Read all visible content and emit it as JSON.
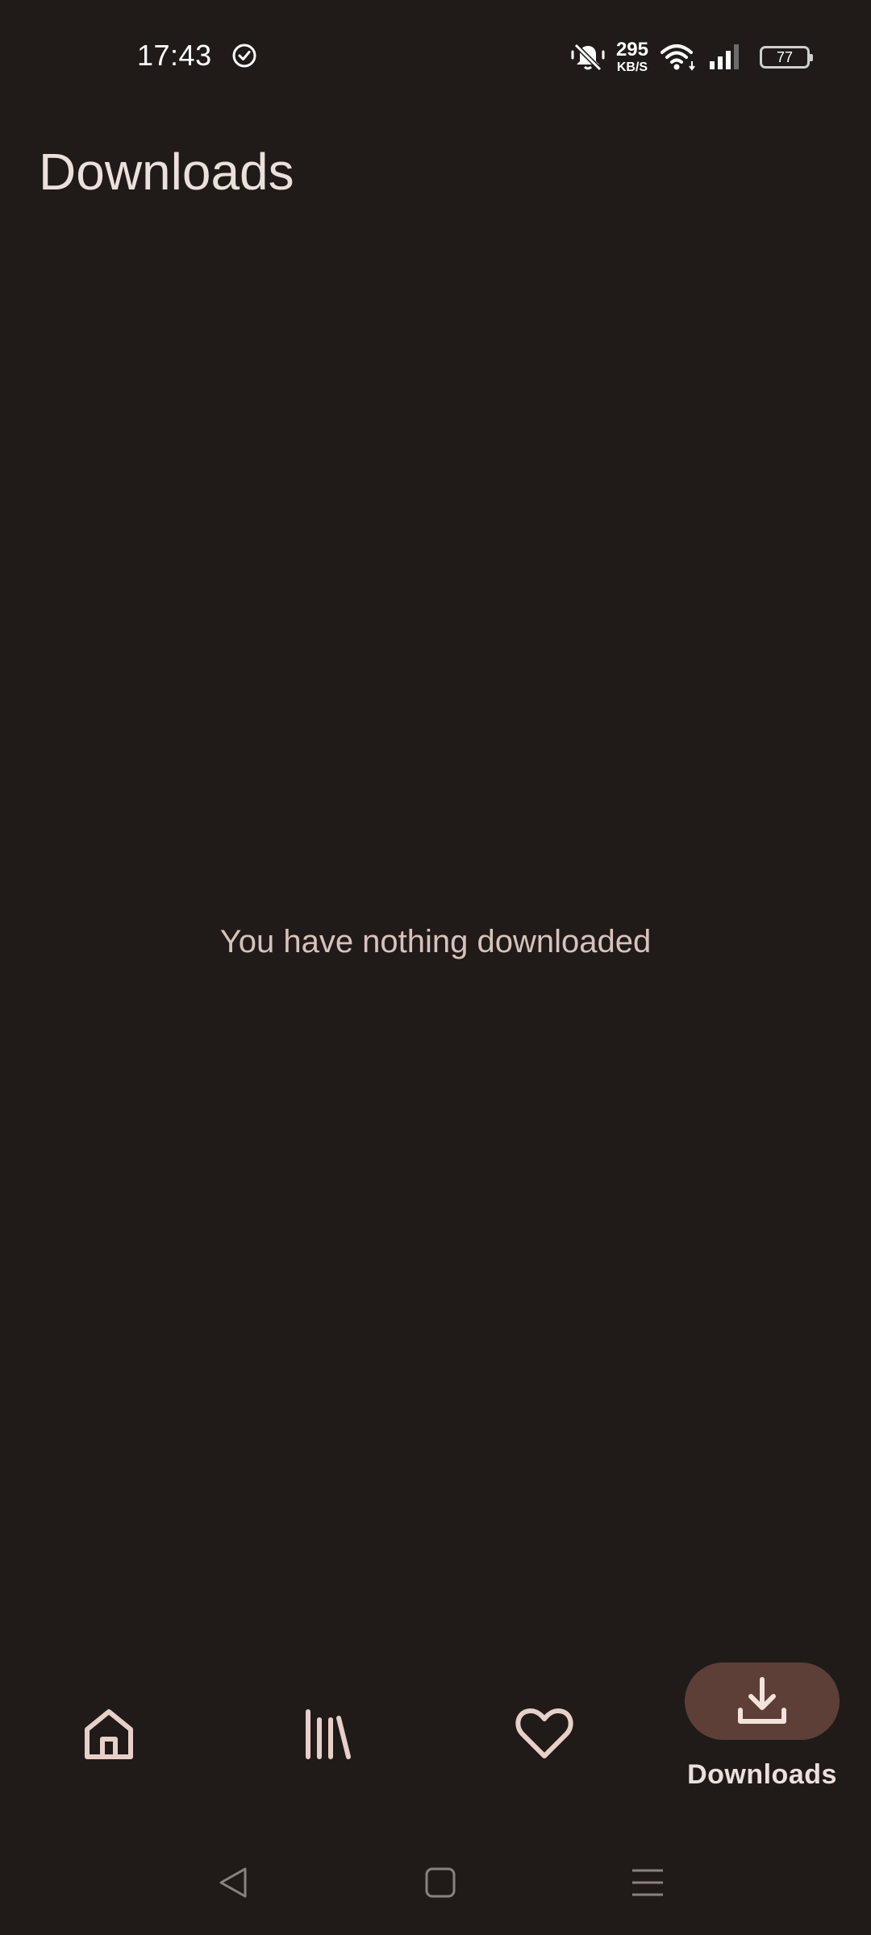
{
  "status_bar": {
    "time": "17:43",
    "net_speed_value": "295",
    "net_speed_unit": "KB/S",
    "battery_level": "77",
    "icons": [
      "check-circle-icon",
      "bell-off-icon",
      "wifi-icon",
      "signal-icon",
      "battery-icon"
    ]
  },
  "page": {
    "title": "Downloads",
    "empty_message": "You have nothing downloaded"
  },
  "bottom_nav": {
    "items": [
      {
        "id": "home",
        "icon": "home-icon",
        "label": "",
        "active": false
      },
      {
        "id": "library",
        "icon": "library-icon",
        "label": "",
        "active": false
      },
      {
        "id": "favorites",
        "icon": "heart-icon",
        "label": "",
        "active": false
      },
      {
        "id": "downloads",
        "icon": "download-icon",
        "label": "Downloads",
        "active": true
      }
    ]
  },
  "system_nav": {
    "icons": [
      "back-icon",
      "home-square-icon",
      "recents-menu-icon"
    ]
  },
  "colors": {
    "background": "#201b19",
    "on_surface": "#ece0dc",
    "secondary_text": "#d8c2bb",
    "active_indicator": "#5d3f38",
    "icon": "#e8d0c9"
  }
}
